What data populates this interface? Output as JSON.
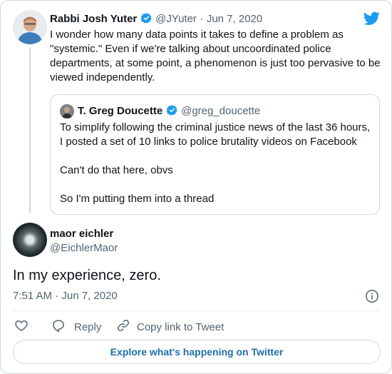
{
  "parent_tweet": {
    "author_name": "Rabbi Josh Yuter",
    "handle": "@JYuter",
    "separator": "·",
    "date": "Jun 7, 2020",
    "text_lines": [
      "I wonder how many data points it takes to define a problem as",
      "\"systemic.\" Even if we're talking about uncoordinated police",
      "departments, at some point, a phenomenon is just too pervasive to be",
      "viewed independently."
    ]
  },
  "quoted_tweet": {
    "author_name": "T. Greg Doucette",
    "handle": "@greg_doucette",
    "text_lines": [
      "To simplify following the criminal justice news of the last 36 hours,",
      "I posted a set of 10 links to police brutality videos on Facebook",
      "",
      "Can't do that here, obvs",
      "",
      "So I'm putting them into a thread"
    ]
  },
  "reply_tweet": {
    "author_name": "maor eichler",
    "handle": "@EichlerMaor",
    "text": "In my experience, zero.",
    "timestamp": "7:51 AM · Jun 7, 2020"
  },
  "actions": {
    "like_label": "",
    "reply_label": "Reply",
    "copy_label": "Copy link to Tweet"
  },
  "footer": {
    "explore_label": "Explore what's happening on Twitter"
  },
  "icons": {
    "brand": "twitter-bird-icon",
    "verified": "verified-badge-icon",
    "info": "info-icon",
    "like": "heart-icon",
    "reply": "speech-bubble-icon",
    "copy": "link-icon"
  },
  "colors": {
    "twitter_blue": "#1d9bf0",
    "text": "#0f1419",
    "muted": "#536471",
    "border": "#cfd9de"
  }
}
